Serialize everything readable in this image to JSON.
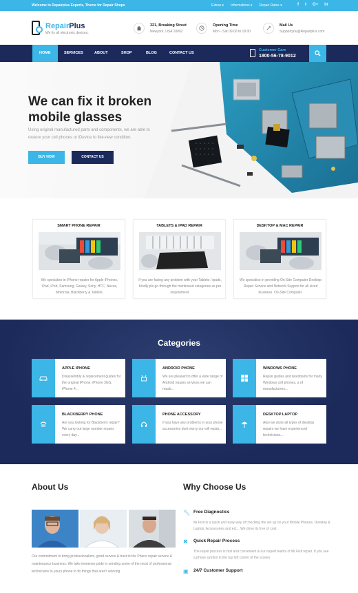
{
  "topbar": {
    "welcome": "Welcome to Repairplus Experts, Theme for Repair Shops",
    "links": [
      "Extras",
      "Informations",
      "Repair Rates"
    ],
    "social": [
      "f",
      "t",
      "G+",
      "in"
    ]
  },
  "header": {
    "brand_a": "Repair",
    "brand_b": "Plus",
    "tagline": "We fix all electronic devices.",
    "info": [
      {
        "title": "321, Breaking Street",
        "sub": "Newyork ,USA 10002",
        "icon": "home-icon"
      },
      {
        "title": "Opening Time",
        "sub": "Mon - Sat 09.00 to 18.00",
        "icon": "clock-icon"
      },
      {
        "title": "Mail Us",
        "sub": "Supportyou@Repairplus.com",
        "icon": "mail-icon"
      }
    ]
  },
  "nav": {
    "items": [
      "HOME",
      "SERVICES",
      "ABOUT",
      "SHOP",
      "BLOG",
      "CONTACT US"
    ],
    "care_label": "Customer Care",
    "care_phone": "1800-56-78-9012"
  },
  "hero": {
    "title": "We can fix it broken mobile glasses",
    "text": "Using original manufactured parts and components, we are able to restore your cell phones or iDevice to like-new condition.",
    "buy": "BUY NOW",
    "contact": "CONTACT US"
  },
  "services": [
    {
      "title": "SMART PHONE REPAIR",
      "text": "We specialise in iPhone repairs for Apple iPhones, iPad, iPod, Samsung, Galaxy, Sony, HTC, Nexus, Motorola, Blackberry & Tablets."
    },
    {
      "title": "TABLETS & IPAD REPAIR",
      "text": "If you are facing any problem with your Tablets / ipads, Kindly pls go through the mentioned categories as per requirement."
    },
    {
      "title": "DESKTOP & MAC REPAIR",
      "text": "We specialise in providing On-Site Computer Desktop Repair Service and Network Support for all sized business. On-Site Computer."
    }
  ],
  "categories": {
    "title": "Categories",
    "items": [
      {
        "name": "APPLE IPHONE",
        "text": "Disassembly & replacement guides for the original iPhone, iPhone 3GS, iPhone 4...",
        "icon": "car-icon"
      },
      {
        "name": "ANDROID PHONE",
        "text": "We are pleased to offer a wide range of Android repairs services we can repair...",
        "icon": "android-icon"
      },
      {
        "name": "WINDOWS PHONE",
        "text": "Repair guides and teardowns for many Windows cell phones, a of manufacturers...",
        "icon": "windows-icon"
      },
      {
        "name": "BLACKBERRY PHONE",
        "text": "Are you looking for Blackberry repair? We carry out large number repairs every day...",
        "icon": "blackberry-icon"
      },
      {
        "name": "PHONE ACCESSORY",
        "text": "If you have any problems in your phone accessories dont worry our will repair...",
        "icon": "headphones-icon"
      },
      {
        "name": "DESKTOP LAPTOP",
        "text": "Also we done all types of desktop repairs we have experienced technicians...",
        "icon": "umbrella-icon"
      }
    ]
  },
  "about": {
    "title": "About Us",
    "text": "Our commitment to bring professionalism, good service & trust to the Phone repair service & maintenance business. We take immense pride in sending some of the most of professional technicians to yours phone to fix things that aren't working."
  },
  "why": {
    "title": "Why Choose Us",
    "items": [
      {
        "title": "Free Diagnostics",
        "text": "Mr.Fixit is a quick and easy way of checking the set up on your Mobile Phones, Desktop & Laptop, Accessories and ect... We done its free of cost.",
        "icon": "wrench-icon"
      },
      {
        "title": "Quick Repair Process",
        "text": "The repair process is fast and convenient & our expert teams of Mr.Fixit repair. If you see a phone symbol in the top left corner of the screen.",
        "icon": "tools-icon"
      },
      {
        "title": "24/7 Customer Support",
        "text": "",
        "icon": "support-icon"
      }
    ]
  },
  "colors": {
    "accent": "#3bb6e6",
    "navy": "#1b2a5a"
  }
}
